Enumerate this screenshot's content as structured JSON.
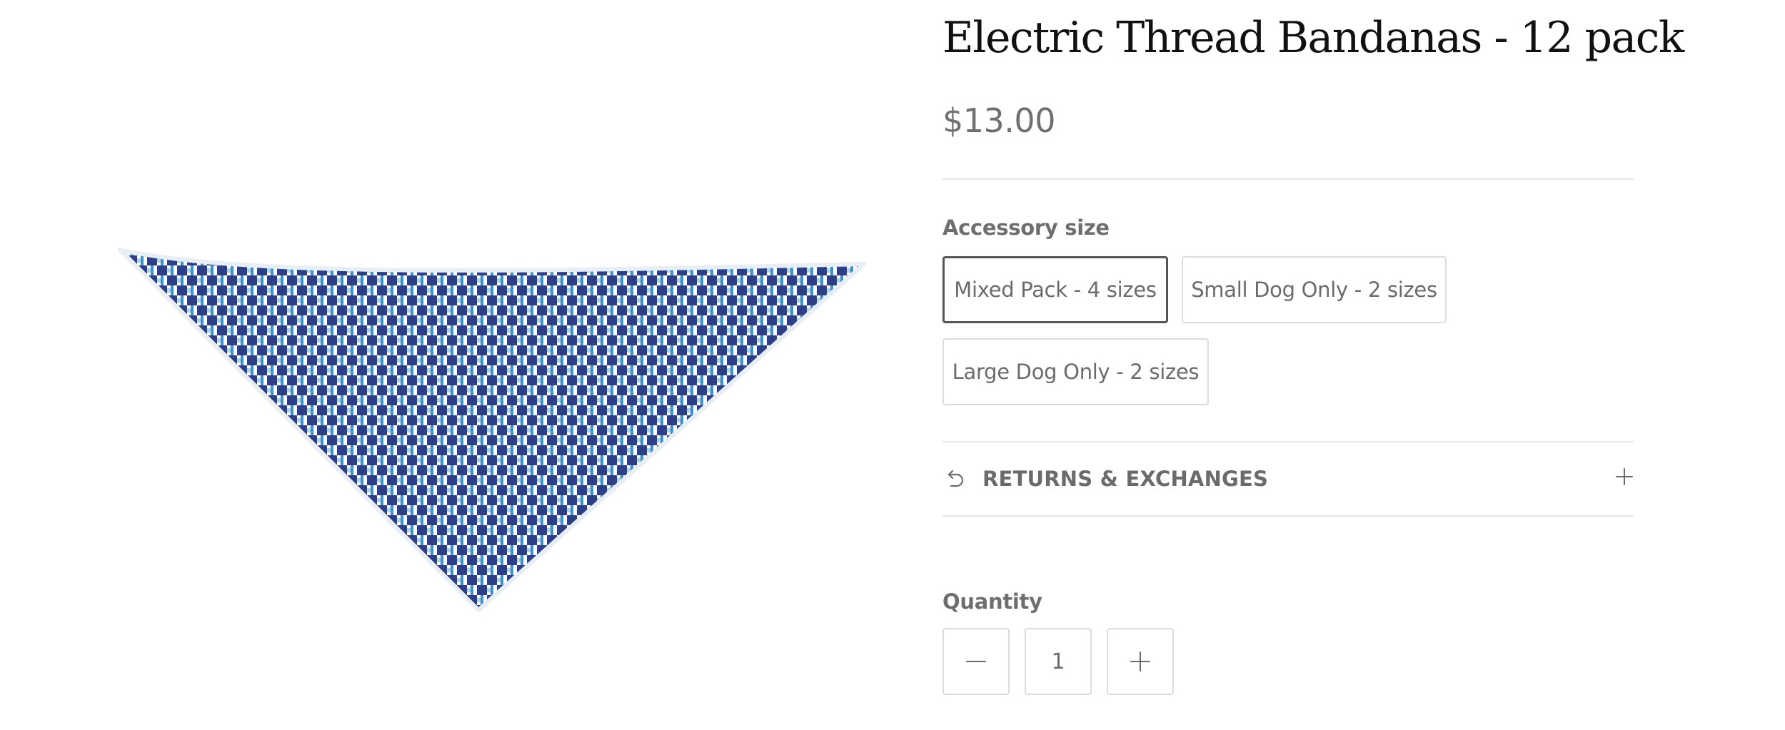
{
  "product": {
    "title": "Electric Thread Bandanas - 12 pack",
    "price": "$13.00",
    "image_icon": "bandana-product-image",
    "image_colors": {
      "dark": "#2e3f86",
      "medium": "#3f8fcf",
      "light": "#a8d4ef",
      "base": "#ffffff"
    }
  },
  "options": {
    "label": "Accessory size",
    "selected_index": 0,
    "values": [
      "Mixed Pack - 4 sizes",
      "Small Dog Only - 2 sizes",
      "Large Dog Only - 2 sizes"
    ]
  },
  "accordion": {
    "label": "RETURNS & EXCHANGES",
    "icon": "return-arrow-icon",
    "toggle_icon": "plus-icon"
  },
  "quantity": {
    "label": "Quantity",
    "value": "1",
    "decrease_icon": "minus-icon",
    "increase_icon": "plus-icon"
  }
}
